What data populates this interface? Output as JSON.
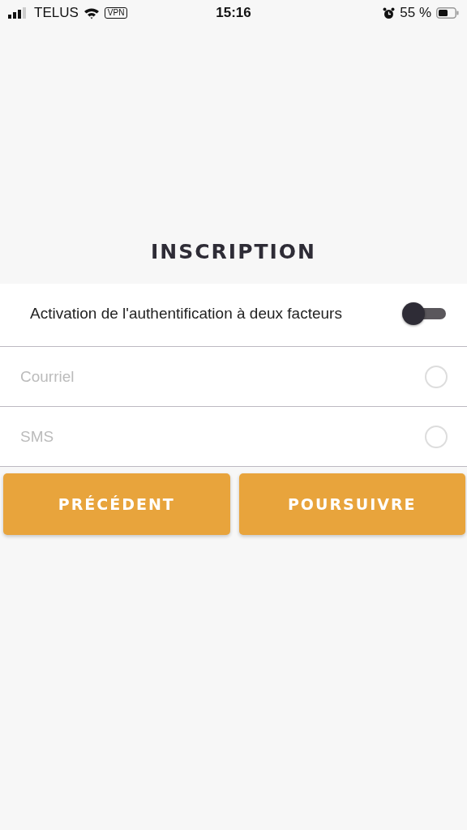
{
  "status_bar": {
    "carrier": "TELUS",
    "vpn": "VPN",
    "time": "15:16",
    "battery": "55 %"
  },
  "title": "INSCRIPTION",
  "two_factor": {
    "label": "Activation de l'authentification à deux facteurs",
    "on": false
  },
  "methods": [
    {
      "label": "Courriel",
      "selected": false
    },
    {
      "label": "SMS",
      "selected": false
    }
  ],
  "buttons": [
    {
      "label": "PRÉCÉDENT"
    },
    {
      "label": "POURSUIVRE"
    }
  ]
}
